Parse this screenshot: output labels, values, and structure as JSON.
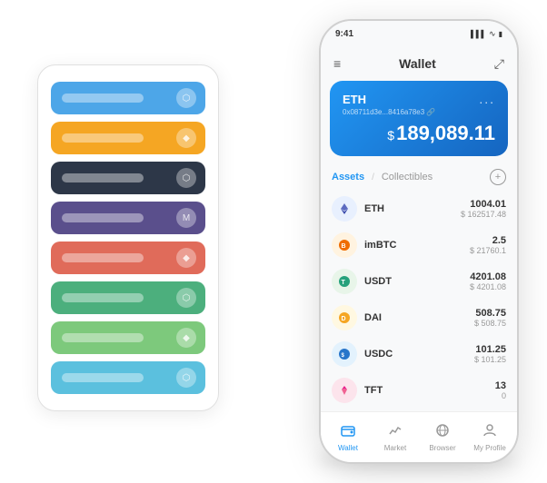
{
  "phone": {
    "status": {
      "time": "9:41",
      "signal": "▌▌▌",
      "wifi": "WiFi",
      "battery": "🔋"
    },
    "header": {
      "menu_icon": "≡",
      "title": "Wallet",
      "expand_icon": "⤢"
    },
    "eth_card": {
      "symbol": "ETH",
      "more": "...",
      "address": "0x08711d3e...8416a78e3 🔗",
      "balance_prefix": "$",
      "balance": "189,089.11"
    },
    "assets_section": {
      "tab_active": "Assets",
      "divider": "/",
      "tab_inactive": "Collectibles",
      "add_icon": "+"
    },
    "assets": [
      {
        "icon": "eth",
        "name": "ETH",
        "amount": "1004.01",
        "usd": "$ 162517.48"
      },
      {
        "icon": "imbtc",
        "name": "imBTC",
        "amount": "2.5",
        "usd": "$ 21760.1"
      },
      {
        "icon": "usdt",
        "name": "USDT",
        "amount": "4201.08",
        "usd": "$ 4201.08"
      },
      {
        "icon": "dai",
        "name": "DAI",
        "amount": "508.75",
        "usd": "$ 508.75"
      },
      {
        "icon": "usdc",
        "name": "USDC",
        "amount": "101.25",
        "usd": "$ 101.25"
      },
      {
        "icon": "tft",
        "name": "TFT",
        "amount": "13",
        "usd": "0"
      }
    ],
    "nav": [
      {
        "label": "Wallet",
        "active": true
      },
      {
        "label": "Market",
        "active": false
      },
      {
        "label": "Browser",
        "active": false
      },
      {
        "label": "My Profile",
        "active": false
      }
    ]
  },
  "card_stack": {
    "cards": [
      {
        "color": "card-blue",
        "label": "Blue card"
      },
      {
        "color": "card-orange",
        "label": "Orange card"
      },
      {
        "color": "card-dark",
        "label": "Dark card"
      },
      {
        "color": "card-purple",
        "label": "Purple card"
      },
      {
        "color": "card-red",
        "label": "Red card"
      },
      {
        "color": "card-green",
        "label": "Green card"
      },
      {
        "color": "card-light-green",
        "label": "Light green card"
      },
      {
        "color": "card-sky",
        "label": "Sky blue card"
      }
    ]
  }
}
